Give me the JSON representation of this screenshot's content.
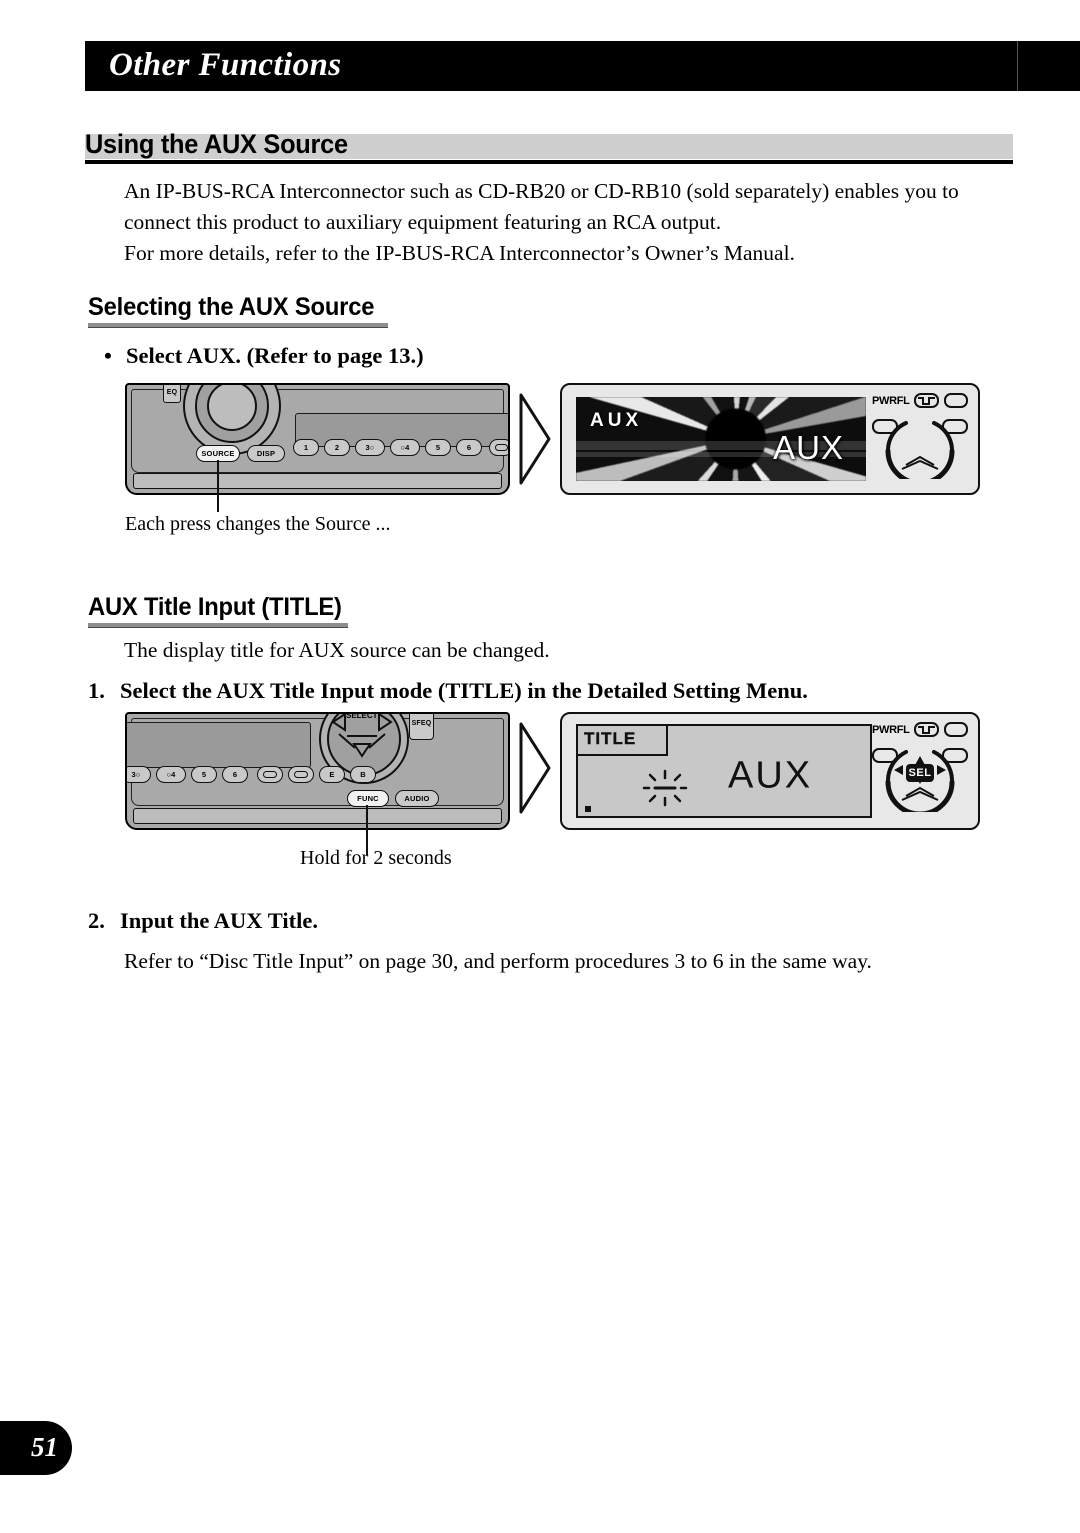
{
  "header": {
    "chapter_title": "Other Functions"
  },
  "sections": {
    "h1": "Using the AUX Source",
    "intro_paragraph_1": "An IP-BUS-RCA Interconnector such as CD-RB20 or CD-RB10 (sold separately) enables you to connect this product to auxiliary equipment featuring an RCA output.",
    "intro_paragraph_2": "For more details, refer to the IP-BUS-RCA Interconnector’s Owner’s Manual.",
    "h2_selecting": "Selecting the AUX Source",
    "bullet_select_aux": "Select AUX. (Refer to page 13.)",
    "h2_title_input": "AUX Title Input (TITLE)",
    "display_title_note": "The display title for AUX source can be changed.",
    "step1_number": "1.",
    "step1_text": "Select the AUX Title Input mode (TITLE) in the Detailed Setting Menu.",
    "step2_number": "2.",
    "step2_text": "Input the AUX Title.",
    "step2_note": "Refer to “Disc Title Input” on page 30, and perform procedures 3 to 6 in the same way."
  },
  "figure1": {
    "caption": "Each press changes the Source ...",
    "faceplate_buttons": {
      "eq": "EQ",
      "source": "SOURCE",
      "disp": "DISP",
      "presets": [
        "1",
        "2",
        "3○",
        "○4",
        "5",
        "6"
      ]
    },
    "display": {
      "aux_small": "AUX",
      "aux_big": "AUX",
      "pwrfl_label": "PWRFL"
    }
  },
  "figure2": {
    "caption": "Hold for 2 seconds",
    "faceplate_buttons": {
      "select": "SELECT",
      "sfeq": "SFEQ",
      "func": "FUNC",
      "audio": "AUDIO",
      "presets": [
        "3○",
        "○4",
        "5",
        "6",
        "E",
        "B"
      ]
    },
    "display": {
      "tab_label": "TITLE",
      "aux_text": "AUX",
      "pwrfl_label": "PWRFL",
      "sel_label": "SEL"
    }
  },
  "footer": {
    "page_number": "51"
  }
}
